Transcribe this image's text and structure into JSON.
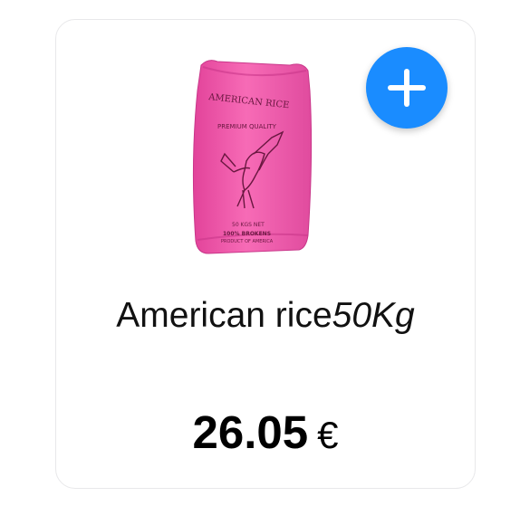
{
  "product": {
    "name": "American rice",
    "weight": "50Kg",
    "price": "26.05",
    "currency": "€",
    "image": {
      "icon": "rice-sack-image",
      "bag_color": "#f25aa8",
      "bag_print": {
        "brand": "AMERICAN RICE",
        "quality": "PREMIUM QUALITY",
        "net_weight": "50 KGS NET",
        "grade": "100% BROKENS",
        "origin": "PRODUCT OF AMERICA"
      }
    }
  },
  "add_button": {
    "icon": "plus-icon",
    "color": "#1a8cff"
  }
}
